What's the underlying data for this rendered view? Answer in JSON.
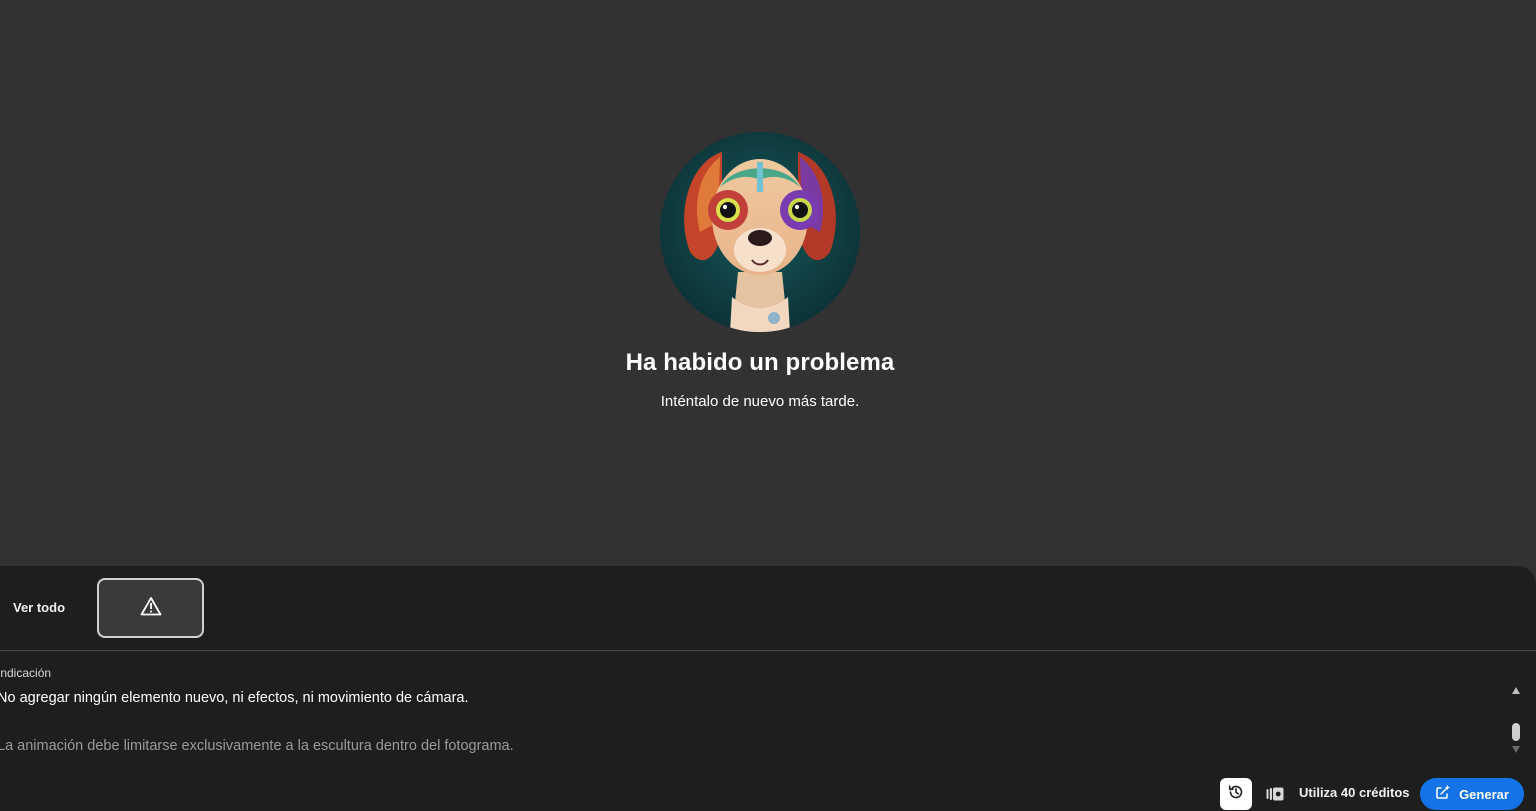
{
  "error": {
    "title": "Ha habido un problema",
    "subtitle": "Inténtalo de nuevo más tarde."
  },
  "gallery": {
    "see_all_label": "Ver todo",
    "thumbnail_icon": "warning-icon"
  },
  "prompt": {
    "label": "Indicación",
    "line1": "No agregar ningún elemento nuevo, ni efectos, ni movimiento de cámara.",
    "line2": "La animación debe limitarse exclusivamente a la escultura dentro del fotograma."
  },
  "footer": {
    "history_icon": "history-icon",
    "credits_icon": "credits-icon",
    "credits_label": "Utiliza 40 créditos",
    "generate_label": "Generar",
    "generate_icon": "generate-sparkle-icon"
  },
  "colors": {
    "background": "#323232",
    "panel": "#1e1e1e",
    "accent": "#1473e6"
  }
}
